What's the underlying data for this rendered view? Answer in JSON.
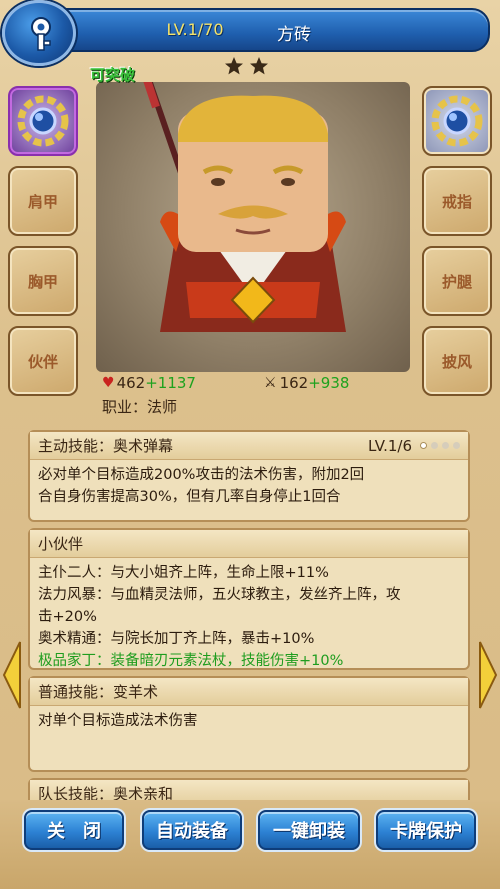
{
  "header": {
    "level": "LV.1/70",
    "name": "方砖",
    "breakthrough": "可突破",
    "stars": 2,
    "back_icon": "key-icon"
  },
  "slots": {
    "left": [
      {
        "label": "",
        "icon": "gear-gem-icon",
        "selected": true
      },
      {
        "label": "肩甲"
      },
      {
        "label": "胸甲"
      },
      {
        "label": "伙伴"
      }
    ],
    "right": [
      {
        "label": "",
        "icon": "gear-gem-icon"
      },
      {
        "label": "戒指"
      },
      {
        "label": "护腿"
      },
      {
        "label": "披风"
      }
    ]
  },
  "stats": {
    "hp": "462",
    "hp_bonus": "+1137",
    "attack": "162",
    "attack_bonus": "+938",
    "job": "职业：法师"
  },
  "active_skill": {
    "title": "主动技能：奥术弹幕",
    "level": "LV.1/6",
    "desc_line1": "必对单个目标造成200%攻击的法术伤害，附加2回",
    "desc_line2": "合自身伤害提高30%，但有几率自身停止1回合"
  },
  "partner": {
    "title": "小伙伴",
    "lines": [
      "主仆二人：与大小姐齐上阵，生命上限+11%",
      "法力风暴：与血精灵法师，五火球教主，发丝齐上阵，攻",
      "击+20%",
      "奥术精通：与院长加丁齐上阵，暴击+10%"
    ],
    "green_line": "极品家丁：装备暗刃元素法杖，技能伤害+10%"
  },
  "normal_skill": {
    "title": "普通技能：变羊术",
    "desc": "对单个目标造成法术伤害"
  },
  "leader_skill": {
    "title": "队长技能：奥术亲和"
  },
  "buttons": {
    "close": "关　闭",
    "auto_equip": "自动装备",
    "unequip_all": "一键卸装",
    "card_protect": "卡牌保护"
  },
  "colors": {
    "banner_blue": "#1f5fae",
    "level_yellow": "#f5e36a",
    "bonus_green": "#1ea21e",
    "parchment": "#efe0bb"
  }
}
